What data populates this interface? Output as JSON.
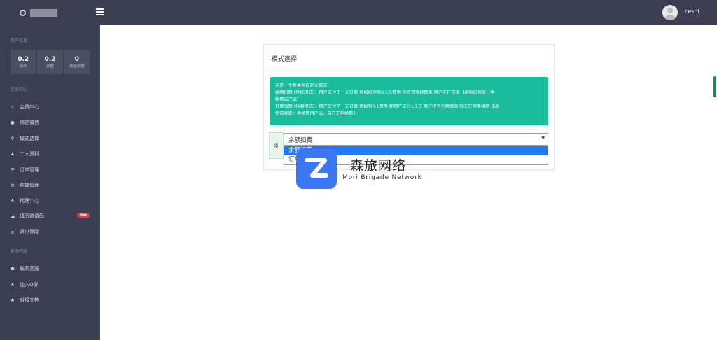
{
  "header": {
    "username": "ceshi"
  },
  "sidebar": {
    "section_user": "用户信息",
    "stats": [
      {
        "value": "0.2",
        "label": "流水"
      },
      {
        "value": "0.2",
        "label": "余额"
      },
      {
        "value": "0",
        "label": "冻结余额"
      }
    ],
    "section_member": "会员中心",
    "items": [
      {
        "label": "会员中心",
        "icon": "home-icon"
      },
      {
        "label": "绑定微信",
        "icon": "wechat-icon"
      },
      {
        "label": "模式选择",
        "icon": "gear-icon"
      },
      {
        "label": "个人资料",
        "icon": "user-icon"
      },
      {
        "label": "订单管理",
        "icon": "list-icon"
      },
      {
        "label": "结算管理",
        "icon": "cogs-icon"
      },
      {
        "label": "代理中心",
        "icon": "users-icon"
      },
      {
        "label": "填写邀请码",
        "icon": "cloud-icon",
        "badge": "Hot"
      },
      {
        "label": "退出登陆",
        "icon": "logout-icon"
      }
    ],
    "section_more": "更多内容",
    "more_items": [
      {
        "label": "联系客服",
        "icon": "support-icon"
      },
      {
        "label": "加入Q群",
        "icon": "group-icon"
      },
      {
        "label": "对接文档",
        "icon": "docs-icon"
      }
    ]
  },
  "main": {
    "panel_title": "模式选择",
    "alert_lines": [
      "这是一个新类型自定义模式：",
      "余额扣费 (传统模式)：用户支付了一元订单 假如扣除你0.1元费率 你将有手续费差 用户无任何差【通俗说就是：手",
      "续费自己出】",
      "订单加费 (抖商模式)：用户支付了一元订单 假如有0.1费率 那用户支付1.1元 用户将有全额增加 你无任何手续费【通",
      "俗说就是：手续费用户出，自己无手续费】"
    ],
    "select_value": "余额扣费",
    "options": [
      "余额扣费",
      "订单加费"
    ]
  },
  "watermark": {
    "title": "森旅网络",
    "subtitle": "Mori Brigade Network"
  }
}
